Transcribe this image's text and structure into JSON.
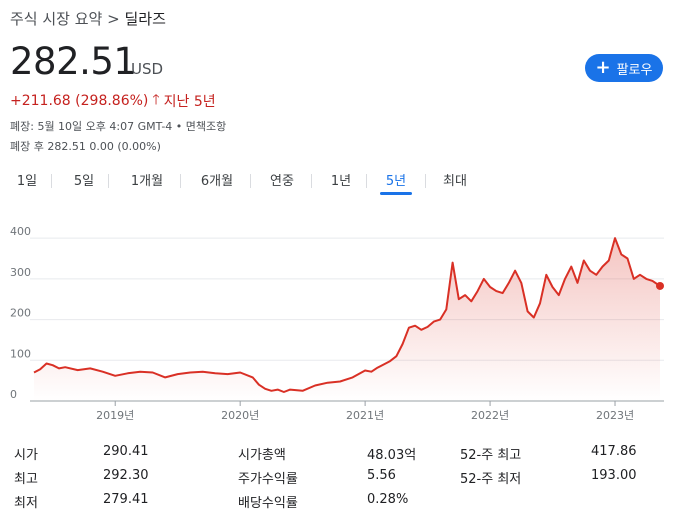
{
  "breadcrumb": {
    "section": "주식 시장 요약",
    "separator": ">",
    "current": "딜라즈"
  },
  "quote": {
    "price": "282.51",
    "currency": "USD",
    "change": "+211.68 (298.86%)",
    "period": "지난 5년"
  },
  "meta": {
    "line1": "폐장: 5월 10일 오후 4:07 GMT-4 • 면책조항",
    "line2": "폐장 후 282.51 0.00 (0.00%)"
  },
  "follow_button": {
    "label": "팔로우"
  },
  "tabs": [
    "1일",
    "5일",
    "1개월",
    "6개월",
    "연중",
    "1년",
    "5년",
    "최대"
  ],
  "active_tab": "5년",
  "colors": {
    "accent": "#1a73e8",
    "down": "#c5221f",
    "line": "#d93025"
  },
  "chart_data": {
    "type": "area",
    "y_ticks": [
      "400",
      "300",
      "200",
      "100",
      "0"
    ],
    "x_ticks": [
      "2019년",
      "2020년",
      "2021년",
      "2022년",
      "2023년"
    ],
    "ylim": [
      0,
      420
    ],
    "x": [
      2018.35,
      2018.4,
      2018.45,
      2018.5,
      2018.55,
      2018.6,
      2018.7,
      2018.8,
      2018.9,
      2019.0,
      2019.1,
      2019.2,
      2019.3,
      2019.4,
      2019.5,
      2019.6,
      2019.7,
      2019.8,
      2019.9,
      2020.0,
      2020.1,
      2020.15,
      2020.2,
      2020.25,
      2020.3,
      2020.35,
      2020.4,
      2020.5,
      2020.6,
      2020.7,
      2020.8,
      2020.9,
      2021.0,
      2021.05,
      2021.1,
      2021.15,
      2021.2,
      2021.25,
      2021.3,
      2021.35,
      2021.4,
      2021.45,
      2021.5,
      2021.55,
      2021.6,
      2021.65,
      2021.7,
      2021.75,
      2021.8,
      2021.85,
      2021.9,
      2021.95,
      2022.0,
      2022.05,
      2022.1,
      2022.15,
      2022.2,
      2022.25,
      2022.3,
      2022.35,
      2022.4,
      2022.45,
      2022.5,
      2022.55,
      2022.6,
      2022.65,
      2022.7,
      2022.75,
      2022.8,
      2022.85,
      2022.9,
      2022.95,
      2023.0,
      2023.05,
      2023.1,
      2023.15,
      2023.2,
      2023.25,
      2023.3,
      2023.36
    ],
    "y": [
      70,
      78,
      92,
      88,
      80,
      83,
      76,
      80,
      72,
      62,
      68,
      72,
      70,
      58,
      66,
      70,
      72,
      68,
      66,
      70,
      58,
      40,
      30,
      25,
      28,
      22,
      28,
      25,
      38,
      45,
      48,
      58,
      75,
      72,
      82,
      90,
      98,
      110,
      140,
      180,
      185,
      175,
      182,
      195,
      200,
      225,
      340,
      250,
      260,
      245,
      270,
      300,
      280,
      270,
      265,
      290,
      320,
      290,
      220,
      205,
      240,
      310,
      280,
      260,
      300,
      330,
      290,
      345,
      320,
      310,
      330,
      345,
      400,
      360,
      350,
      300,
      310,
      300,
      295,
      282.51
    ],
    "last_value": 282.51
  },
  "stats": [
    [
      {
        "label": "시가",
        "value": "290.41"
      },
      {
        "label": "시가총액",
        "value": "48.03억"
      },
      {
        "label": "52-주 최고",
        "value": "417.86"
      }
    ],
    [
      {
        "label": "최고",
        "value": "292.30"
      },
      {
        "label": "주가수익률",
        "value": "5.56"
      },
      {
        "label": "52-주 최저",
        "value": "193.00"
      }
    ],
    [
      {
        "label": "최저",
        "value": "279.41"
      },
      {
        "label": "배당수익률",
        "value": "0.28%"
      }
    ]
  ]
}
